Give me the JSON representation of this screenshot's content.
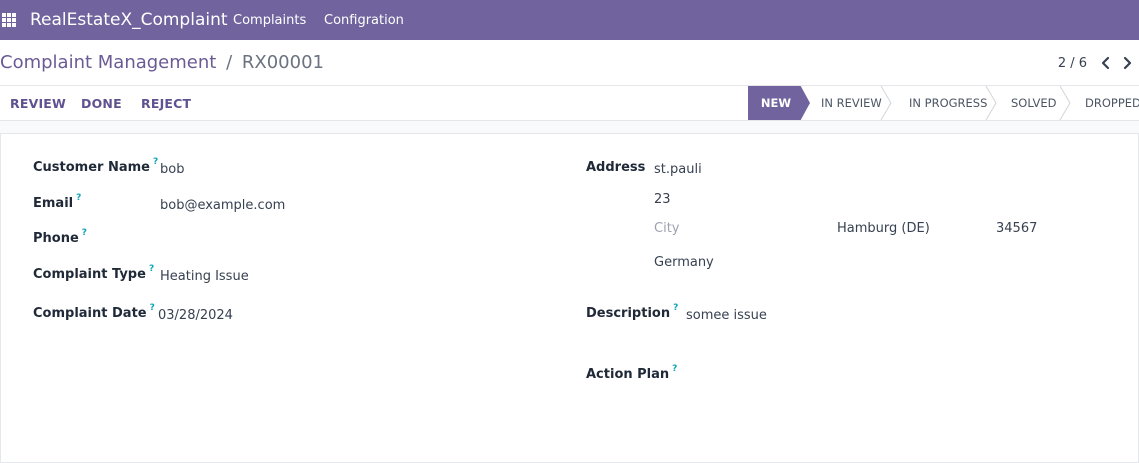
{
  "navbar": {
    "brand": "RealEstateX_Complaint",
    "menu": [
      "Complaints",
      "Configration"
    ]
  },
  "breadcrumb": {
    "parent": "Complaint Management",
    "separator": "/",
    "current": "RX00001"
  },
  "pager": {
    "value": "2 / 6"
  },
  "actions": {
    "review": "REVIEW",
    "done": "DONE",
    "reject": "REJECT"
  },
  "stages": [
    {
      "label": "NEW",
      "active": true
    },
    {
      "label": "IN REVIEW",
      "active": false
    },
    {
      "label": "IN PROGRESS",
      "active": false
    },
    {
      "label": "SOLVED",
      "active": false
    },
    {
      "label": "DROPPED",
      "active": false
    }
  ],
  "form": {
    "customer_name": {
      "label": "Customer Name",
      "value": "bob"
    },
    "email": {
      "label": "Email",
      "value": "bob@example.com"
    },
    "phone": {
      "label": "Phone",
      "value": ""
    },
    "complaint_type": {
      "label": "Complaint Type",
      "value": "Heating Issue"
    },
    "complaint_date": {
      "label": "Complaint Date",
      "value": "03/28/2024"
    },
    "address": {
      "label": "Address",
      "street": "st.pauli",
      "street2": "23",
      "city_placeholder": "City",
      "state": "Hamburg (DE)",
      "zip": "34567",
      "country": "Germany"
    },
    "description": {
      "label": "Description",
      "value": "somee issue"
    },
    "action_plan": {
      "label": "Action Plan",
      "value": ""
    }
  },
  "colors": {
    "navbar": "#71639e",
    "accent": "#5f5290",
    "help": "#0ea5b7"
  },
  "icons": [
    "apps-grid-icon",
    "chevron-left-icon",
    "chevron-right-icon",
    "help-icon"
  ]
}
